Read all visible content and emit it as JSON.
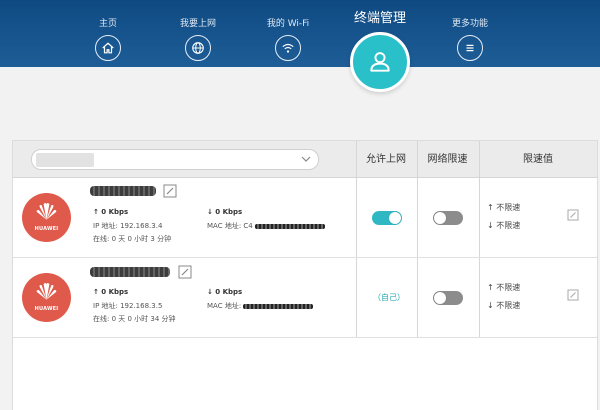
{
  "nav": {
    "items": [
      {
        "label": "主页",
        "icon": "home-icon"
      },
      {
        "label": "我要上网",
        "icon": "globe-icon"
      },
      {
        "label": "我的 Wi-Fi",
        "icon": "wifi-icon"
      },
      {
        "label": "更多功能",
        "icon": "menu-icon"
      }
    ],
    "active": {
      "label": "终端管理",
      "icon": "user-icon"
    }
  },
  "colors": {
    "nav_bg": "#1a5690",
    "accent": "#2ac0c9",
    "toggle_on": "#2fb8c3",
    "toggle_off": "#8c8c8c",
    "brand": "#e05a4c"
  },
  "table": {
    "columns": {
      "allow": "允许上网",
      "net_limit": "网络限速",
      "limit_value": "限速值"
    },
    "search": {
      "placeholder": ""
    },
    "devices": [
      {
        "brand": "HUAWEI",
        "up": "↑ 0 Kbps",
        "down": "↓ 0 Kbps",
        "ip": "IP 地址: 192.168.3.4",
        "mac": "MAC 地址: C4",
        "online": "在线: 0 天 0 小时 3 分钟",
        "allow_internet": true,
        "self_label": "",
        "speed_limit": false,
        "limit_up": "不限速",
        "limit_down": "不限速"
      },
      {
        "brand": "HUAWEI",
        "up": "↑ 0 Kbps",
        "down": "↓ 0 Kbps",
        "ip": "IP 地址: 192.168.3.5",
        "mac": "MAC 地址:",
        "online": "在线: 0 天 0 小时 34 分钟",
        "allow_internet": null,
        "self_label": "（自己）",
        "speed_limit": false,
        "limit_up": "不限速",
        "limit_down": "不限速"
      }
    ]
  }
}
